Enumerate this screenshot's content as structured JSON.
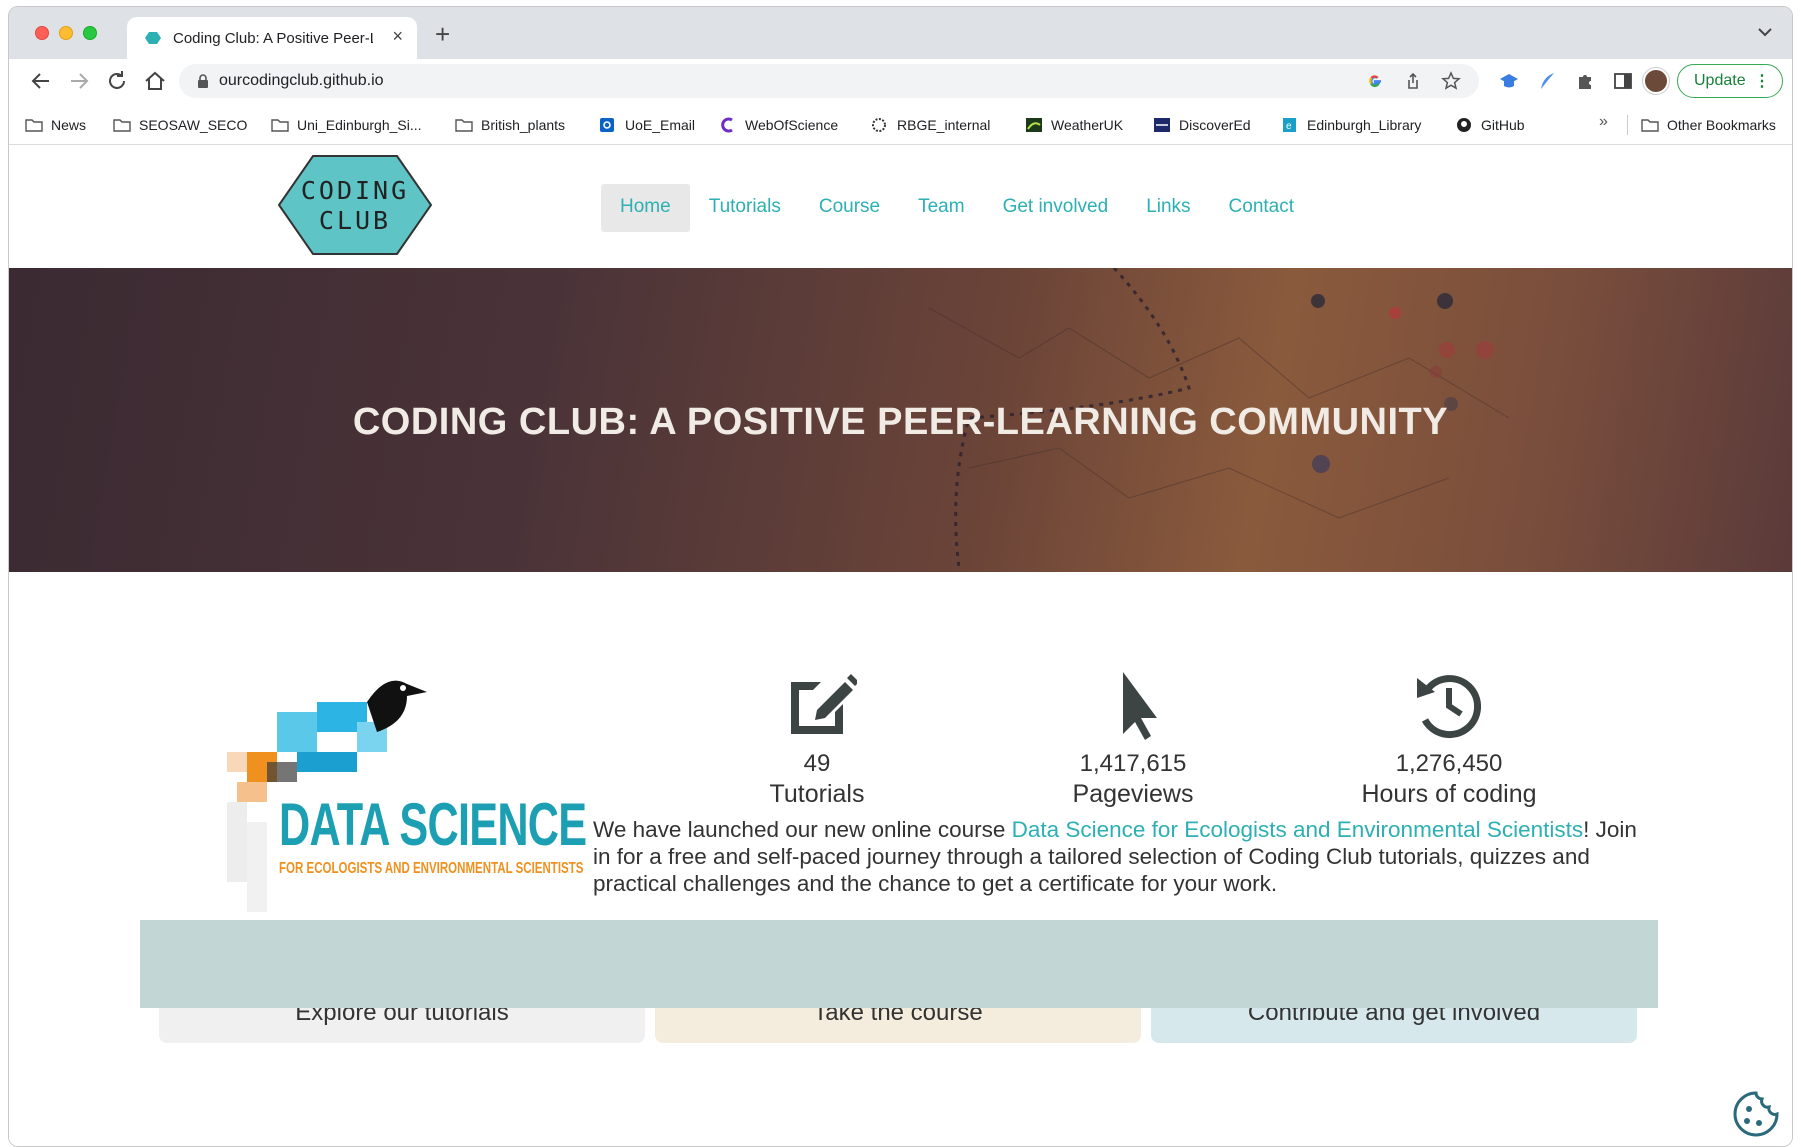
{
  "browser": {
    "tab_title": "Coding Club: A Positive Peer-L",
    "tab_close": "×",
    "new_tab": "+",
    "url": "ourcodingclub.github.io",
    "update_label": "Update",
    "update_menu": "⋮",
    "bookmarks_more": "»",
    "bookmarks": [
      {
        "label": "News",
        "icon": "folder-icon"
      },
      {
        "label": "SEOSAW_SECO",
        "icon": "folder-icon"
      },
      {
        "label": "Uni_Edinburgh_Si...",
        "icon": "folder-icon"
      },
      {
        "label": "British_plants",
        "icon": "folder-icon"
      },
      {
        "label": "UoE_Email",
        "icon": "outlook-icon"
      },
      {
        "label": "WebOfScience",
        "icon": "clarivate-icon"
      },
      {
        "label": "RBGE_internal",
        "icon": "rbge-icon"
      },
      {
        "label": "WeatherUK",
        "icon": "weather-icon"
      },
      {
        "label": "DiscoverEd",
        "icon": "discovered-icon"
      },
      {
        "label": "Edinburgh_Library",
        "icon": "library-icon"
      },
      {
        "label": "GitHub",
        "icon": "github-icon"
      },
      {
        "label": "Other Bookmarks",
        "icon": "folder-icon"
      }
    ]
  },
  "site": {
    "logo_line1": "CODING",
    "logo_line2": "CLUB",
    "nav": [
      "Home",
      "Tutorials",
      "Course",
      "Team",
      "Get involved",
      "Links",
      "Contact"
    ],
    "active_nav": "Home",
    "hero_title": "CODING CLUB: A POSITIVE PEER-LEARNING COMMUNITY",
    "course_logo_title": "DATA SCIENCE",
    "course_logo_subtitle": "FOR ECOLOGISTS AND ENVIRONMENTAL SCIENTISTS",
    "stats": [
      {
        "icon": "edit-icon",
        "value": "49",
        "label": "Tutorials"
      },
      {
        "icon": "cursor-icon",
        "value": "1,417,615",
        "label": "Pageviews"
      },
      {
        "icon": "history-icon",
        "value": "1,276,450",
        "label": "Hours of coding"
      }
    ],
    "blurb_before": "We have launched our new online course ",
    "blurb_link": "Data Science for Ecologists and Environmental Scientists",
    "blurb_after": "! Join in for a free and self-paced journey through a tailored selection of Coding Club tutorials, quizzes and practical challenges and the chance to get a certificate for your work.",
    "cta": [
      {
        "label": "Explore our tutorials",
        "color": "#f0f0f0"
      },
      {
        "label": "Take the course",
        "color": "#f4ecdd"
      },
      {
        "label": "Contribute and get involved",
        "color": "#d6e8ec"
      }
    ]
  },
  "colors": {
    "accent": "#2db0b3",
    "hero_text": "#f1ebe6",
    "update_green": "#188038"
  }
}
